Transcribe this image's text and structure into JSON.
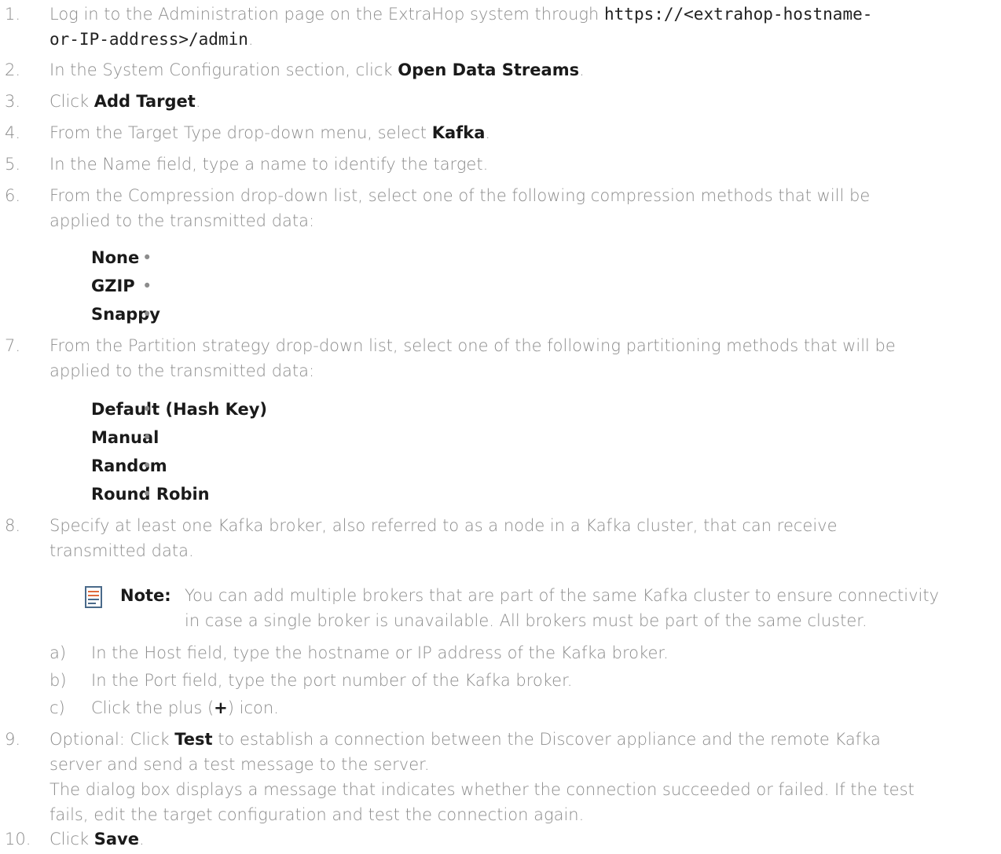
{
  "steps": [
    {
      "num": "1.",
      "line1_text": "Log in to the Administration page on the ExtraHop system through ",
      "line1_code": "https://<extrahop-hostname-",
      "line2_code": "or-IP-address>/admin",
      "line2_text": "."
    },
    {
      "num": "2.",
      "pre": "In the System Configuration section, click ",
      "strong": "Open Data Streams",
      "post": "."
    },
    {
      "num": "3.",
      "pre": "Click ",
      "strong": "Add Target",
      "post": "."
    },
    {
      "num": "4.",
      "pre": "From the Target Type drop-down menu, select ",
      "strong": "Kafka",
      "post": "."
    },
    {
      "num": "5.",
      "text": "In the Name field, type a name to identify the target."
    },
    {
      "num": "6.",
      "line1": "From the Compression drop-down list, select one of the following compression methods that will be",
      "line2": "applied to the transmitted data:",
      "options": [
        "None",
        "GZIP",
        "Snappy"
      ]
    },
    {
      "num": "7.",
      "line1": "From the Partition strategy drop-down list, select one of the following partitioning methods that will be",
      "line2": "applied to the transmitted data:",
      "options": [
        "Default (Hash Key)",
        "Manual",
        "Random",
        "Round Robin"
      ]
    },
    {
      "num": "8.",
      "line1": "Specify at least one Kafka broker, also referred to as a node in a Kafka cluster, that can receive",
      "line2": "transmitted data.",
      "note_label": "Note:",
      "note_line1": "You can add multiple brokers that are part of the same Kafka cluster to ensure connectivity",
      "note_line2": "in case a single broker is unavailable. All brokers must be part of the same cluster.",
      "substeps": [
        {
          "letter": "a)",
          "text": "In the Host field, type the hostname or IP address of the Kafka broker."
        },
        {
          "letter": "b)",
          "text": "In the Port field, type the port number of the Kafka broker."
        },
        {
          "letter": "c)",
          "pre": "Click the plus (",
          "strong": "+",
          "post": ") icon."
        }
      ]
    },
    {
      "num": "9.",
      "pre": "Optional: Click ",
      "strong": "Test",
      "post": " to establish a connection between the Discover appliance and the remote Kafka",
      "line2": "server and send a test message to the server.",
      "line3": "The dialog box displays a message that indicates whether the connection succeeded or failed. If the test",
      "line4": "fails, edit the target configuration and test the connection again."
    },
    {
      "num": "10.",
      "pre": "Click ",
      "strong": "Save",
      "post": "."
    }
  ],
  "icons": {
    "note": "note-icon"
  },
  "colors": {
    "body_text": "#8c8c8c",
    "emphasis_text": "#1a1a1a",
    "note_icon": "#4a6a8a"
  }
}
